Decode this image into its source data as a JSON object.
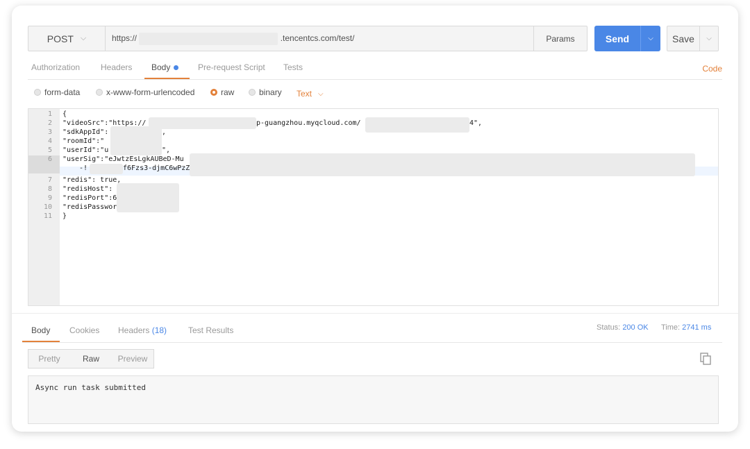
{
  "request": {
    "method": "POST",
    "url_prefix": "https://",
    "url_suffix": ".tencentcs.com/test/",
    "params_label": "Params",
    "send_label": "Send",
    "save_label": "Save"
  },
  "request_tabs": [
    "Authorization",
    "Headers",
    "Body",
    "Pre-request Script",
    "Tests"
  ],
  "active_request_tab": "Body",
  "code_link": "Code",
  "body_types": [
    "form-data",
    "x-www-form-urlencoded",
    "raw",
    "binary"
  ],
  "selected_body_type": "raw",
  "raw_format": "Text",
  "editor": {
    "line_numbers": [
      "1",
      "2",
      "3",
      "4",
      "5",
      "6",
      "7",
      "8",
      "9",
      "10",
      "11"
    ],
    "lines": [
      "{",
      "\"videoSrc\":\"https://",
      "p-guangzhou.myqcloud.com/",
      "4\",",
      "\"sdkAppId\":",
      ",",
      "\"roomId\":\"",
      "\"userId\":\"u",
      "\",",
      "\"userSig\":\"eJwtzEsLgkAUBeD-Mu",
      "-!",
      "f6Fzs3-djmC6wPzZ",
      "\"redis\": true,",
      "\"redisHost\":",
      "\"redisPort\":6",
      "\"redisPasswor",
      "}"
    ]
  },
  "response": {
    "tabs": [
      "Body",
      "Cookies",
      "Headers",
      "Test Results"
    ],
    "headers_count": "(18)",
    "status_label": "Status:",
    "status_value": "200 OK",
    "time_label": "Time:",
    "time_value": "2741 ms",
    "view_modes": [
      "Pretty",
      "Raw",
      "Preview"
    ],
    "active_view": "Raw",
    "body_text": "Async run task submitted"
  },
  "colors": {
    "accent_orange": "#e3813a",
    "send_blue": "#4a87e6"
  }
}
